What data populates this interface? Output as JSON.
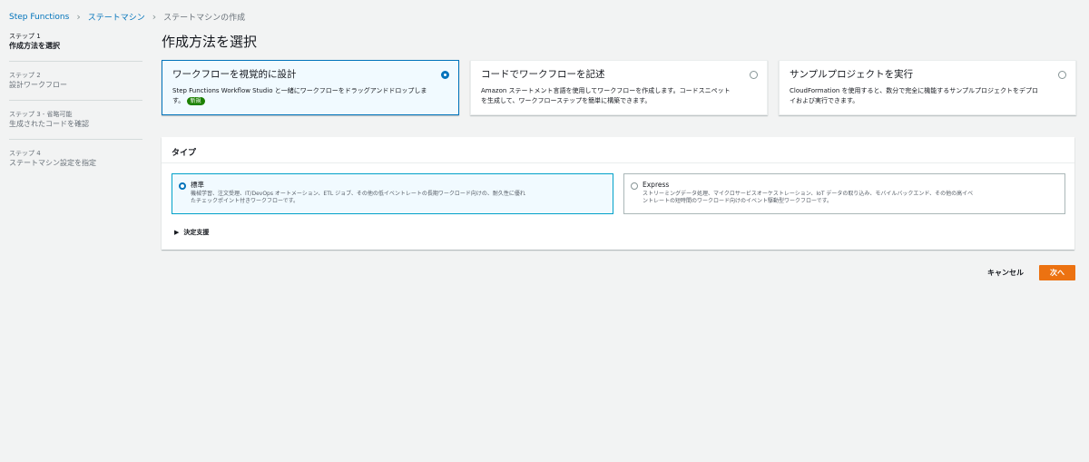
{
  "breadcrumb": {
    "items": [
      "Step Functions",
      "ステートマシン",
      "ステートマシンの作成"
    ]
  },
  "steps": [
    {
      "num": "ステップ 1",
      "name": "作成方法を選択",
      "active": true
    },
    {
      "num": "ステップ 2",
      "name": "設計ワークフロー"
    },
    {
      "num": "ステップ 3",
      "optional": "- 省略可能",
      "name": "生成されたコードを確認"
    },
    {
      "num": "ステップ 4",
      "name": "ステートマシン設定を指定"
    }
  ],
  "page_title": "作成方法を選択",
  "methods": [
    {
      "title": "ワークフローを視覚的に設計",
      "desc": "Step Functions Workflow Studio と一緒にワークフローをドラッグアンドドロップしま",
      "desc2": "す。",
      "badge": "新規",
      "selected": true
    },
    {
      "title": "コードでワークフローを記述",
      "desc": "Amazon ステートメント言語を使用してワークフローを作成します。コードスニペット",
      "desc2": "を生成して、ワークフローステップを簡単に構築できます。"
    },
    {
      "title": "サンプルプロジェクトを実行",
      "desc": "CloudFormation を使用すると、数分で完全に機能するサンプルプロジェクトをデプロ",
      "desc2": "イおよび実行できます。"
    }
  ],
  "type_panel": {
    "header": "タイプ",
    "options": [
      {
        "title": "標準",
        "desc": "機械学習、注文受理、IT/DevOps オートメーション、ETL ジョブ、その他の低イベントレートの長期ワークロード向けの、耐久性に優れ",
        "desc2": "たチェックポイント付きワークフローです。",
        "selected": true
      },
      {
        "title": "Express",
        "desc": "ストリーミングデータ処理、マイクロサービスオーケストレーション、IoT データの取り込み、モバイルバックエンド、その他の高イベ",
        "desc2": "ントレートの短時間のワークロード向けのイベント駆動型ワークフローです。"
      }
    ],
    "decision": "決定支援"
  },
  "actions": {
    "cancel": "キャンセル",
    "next": "次へ"
  },
  "colors": {
    "primary": "#ec7211",
    "link": "#0073bb",
    "new_badge": "#1d8102"
  }
}
